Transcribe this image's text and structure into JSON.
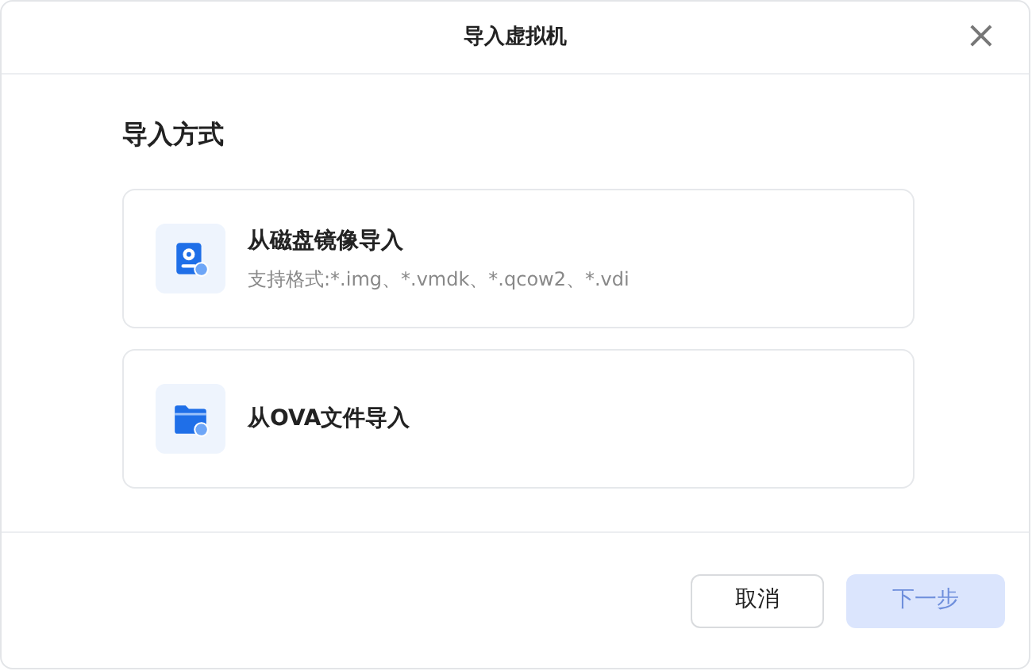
{
  "dialog": {
    "title": "导入虚拟机",
    "close_symbol": "×"
  },
  "section_title": "导入方式",
  "options": [
    {
      "kind": "disk",
      "title": "从磁盘镜像导入",
      "subtitle": "支持格式:*.img、*.vmdk、*.qcow2、*.vdi",
      "selected": false
    },
    {
      "kind": "folder",
      "title": "从OVA文件导入",
      "selected": false
    }
  ],
  "buttons": {
    "cancel": {
      "label": "取消"
    },
    "next": {
      "label": "下一步",
      "disabled": true
    }
  }
}
